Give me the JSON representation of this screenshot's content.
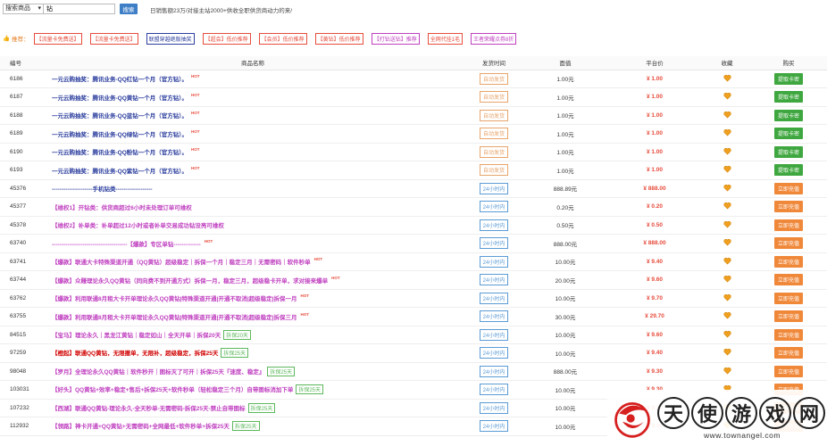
{
  "search": {
    "select_value": "搜索商品",
    "input_value": "钻",
    "button_label": "搜索"
  },
  "banner": "日销售额23万/对接主站2000+供收全职供货商动力的来/",
  "recommend": {
    "label": "推荐：",
    "tags": [
      {
        "text": "【流量卡免费送】",
        "style": "red"
      },
      {
        "text": "【流量卡免费送】",
        "style": "red"
      },
      {
        "text": "联盟穿越绝版抽奖",
        "style": "blue"
      },
      {
        "text": "【超会】低价推荐",
        "style": "red"
      },
      {
        "text": "【会员】低价推荐",
        "style": "red"
      },
      {
        "text": "【黄钻】低价推荐",
        "style": "red"
      },
      {
        "text": "【打钻送钻】推荐",
        "style": "pink"
      },
      {
        "text": "全网代挂1毛",
        "style": "red"
      },
      {
        "text": "王者荣耀点券8折",
        "style": "pink"
      }
    ]
  },
  "table": {
    "headers": [
      "编号",
      "商品名称",
      "发货时间",
      "面值",
      "平台价",
      "收藏",
      "购买"
    ],
    "rows": [
      {
        "id": "6186",
        "name": "一元云购抽奖：腾讯业务-QQ红钻一个月（官方钻）。",
        "hot": "HOT",
        "tag": "",
        "color": "#2c3e9e",
        "time": "自动发货",
        "time_style": "orange",
        "face": "1.00元",
        "price": "¥ 1.00",
        "buy": "提取卡密",
        "buy_style": "green"
      },
      {
        "id": "6187",
        "name": "一元云购抽奖：腾讯业务-QQ黄钻一个月（官方钻）。",
        "hot": "HOT",
        "tag": "",
        "color": "#2c3e9e",
        "time": "自动发货",
        "time_style": "orange",
        "face": "1.00元",
        "price": "¥ 1.00",
        "buy": "提取卡密",
        "buy_style": "green"
      },
      {
        "id": "6188",
        "name": "一元云购抽奖：腾讯业务-QQ蓝钻一个月（官方钻）。",
        "hot": "HOT",
        "tag": "",
        "color": "#2c3e9e",
        "time": "自动发货",
        "time_style": "orange",
        "face": "1.00元",
        "price": "¥ 1.00",
        "buy": "提取卡密",
        "buy_style": "green"
      },
      {
        "id": "6189",
        "name": "一元云购抽奖：腾讯业务-QQ绿钻一个月（官方钻）。",
        "hot": "HOT",
        "tag": "",
        "color": "#2c3e9e",
        "time": "自动发货",
        "time_style": "orange",
        "face": "1.00元",
        "price": "¥ 1.00",
        "buy": "提取卡密",
        "buy_style": "green"
      },
      {
        "id": "6190",
        "name": "一元云购抽奖：腾讯业务-QQ粉钻一个月（官方钻）。",
        "hot": "HOT",
        "tag": "",
        "color": "#2c3e9e",
        "time": "自动发货",
        "time_style": "orange",
        "face": "1.00元",
        "price": "¥ 1.00",
        "buy": "提取卡密",
        "buy_style": "green"
      },
      {
        "id": "6193",
        "name": "一元云购抽奖：腾讯业务-QQ紫钻一个月（官方钻）。",
        "hot": "HOT",
        "tag": "",
        "color": "#2c3e9e",
        "time": "自动发货",
        "time_style": "orange",
        "face": "1.00元",
        "price": "¥ 1.00",
        "buy": "提取卡密",
        "buy_style": "green"
      },
      {
        "id": "45376",
        "name": "---------------------手机钻类-------------------",
        "hot": "",
        "tag": "",
        "color": "#2c3e9e",
        "time": "24小时内",
        "time_style": "blue",
        "face": "888.89元",
        "price": "¥ 888.00",
        "buy": "立即充值",
        "buy_style": "orange"
      },
      {
        "id": "45377",
        "name": "【维权1】开钻类：供货商超过6小时未处理订单可维权",
        "hot": "",
        "tag": "",
        "color": "#c040c0",
        "time": "24小时内",
        "time_style": "blue",
        "face": "0.20元",
        "price": "¥ 0.20",
        "buy": "立即充值",
        "buy_style": "orange"
      },
      {
        "id": "45378",
        "name": "【维权2】补单类：补单超过12小时或者补单交易成功钻没亮可维权",
        "hot": "",
        "tag": "",
        "color": "#c040c0",
        "time": "24小时内",
        "time_style": "blue",
        "face": "0.50元",
        "price": "¥ 0.50",
        "buy": "立即充值",
        "buy_style": "orange"
      },
      {
        "id": "63740",
        "name": "---------------------------------------【爆款】专区单钻--------------",
        "hot": "HOT",
        "tag": "",
        "color": "#c040c0",
        "time": "24小时内",
        "time_style": "blue",
        "face": "888.00元",
        "price": "¥ 888.00",
        "buy": "立即充值",
        "buy_style": "orange"
      },
      {
        "id": "63741",
        "name": "【爆款】联通大卡特殊渠道开通（QQ黄钻）超级稳定｜拆保一个月｜稳定三月｜无需密码｜软件秒单",
        "hot": "HOT",
        "tag": "",
        "color": "#c040c0",
        "time": "24小时内",
        "time_style": "blue",
        "face": "10.00元",
        "price": "¥ 9.40",
        "buy": "立即充值",
        "buy_style": "orange"
      },
      {
        "id": "63744",
        "name": "【爆款】众赚理论永久QQ黄钻（同向费不到开通方式）拆保一月，稳定三月，超级稳卡开单，求对接来爆单",
        "hot": "HOT",
        "tag": "",
        "color": "#c040c0",
        "time": "24小时内",
        "time_style": "blue",
        "face": "20.00元",
        "price": "¥ 9.60",
        "buy": "立即充值",
        "buy_style": "orange"
      },
      {
        "id": "63762",
        "name": "【爆款】利用联通8月租大卡开单理论永久QQ黄钻|特殊渠道开通|开通不取消|超级稳定|拆保一月",
        "hot": "HOT",
        "tag": "",
        "color": "#c040c0",
        "time": "24小时内",
        "time_style": "blue",
        "face": "10.00元",
        "price": "¥ 9.70",
        "buy": "立即充值",
        "buy_style": "orange"
      },
      {
        "id": "63755",
        "name": "【爆款】利用联通8月租大卡开单理论永久QQ黄钻|特殊渠道开通|开通不取消|超级稳定|拆保三月",
        "hot": "HOT",
        "tag": "",
        "color": "#c040c0",
        "time": "24小时内",
        "time_style": "blue",
        "face": "30.00元",
        "price": "¥ 29.70",
        "buy": "立即充值",
        "buy_style": "orange"
      },
      {
        "id": "84515",
        "name": "【宝马】理论永久｜黑龙江黄钻｜稳定如山｜全天开单｜拆保20天",
        "hot": "",
        "tag": "拆保20天",
        "color": "#c040c0",
        "time": "24小时内",
        "time_style": "blue",
        "face": "10.00元",
        "price": "¥ 9.60",
        "buy": "立即充值",
        "buy_style": "orange"
      },
      {
        "id": "97259",
        "name": "【橙起】联通QQ黄钻，无限撤单，无限补，超级稳定，拆保25天",
        "hot": "",
        "tag": "拆保25天",
        "color": "#d00000",
        "time": "24小时内",
        "time_style": "blue",
        "face": "10.00元",
        "price": "¥ 9.40",
        "buy": "立即充值",
        "buy_style": "orange"
      },
      {
        "id": "98048",
        "name": "【罗月】全理论永久QQ黄钻｜软件秒开｜图标灭了可开｜拆保25天『速度、稳定』",
        "hot": "",
        "tag": "拆保25天",
        "color": "#c040c0",
        "time": "24小时内",
        "time_style": "blue",
        "face": "888.00元",
        "price": "¥ 9.30",
        "buy": "立即充值",
        "buy_style": "orange"
      },
      {
        "id": "103031",
        "name": "【好头】QQ黄钻+效率+稳定+售后+拆保25天+软件秒单（轻松稳定三个月）自带图标消加下单",
        "hot": "",
        "tag": "拆保25天",
        "color": "#c040c0",
        "time": "24小时内",
        "time_style": "blue",
        "face": "10.00元",
        "price": "¥ 9.30",
        "buy": "立即充值",
        "buy_style": "orange"
      },
      {
        "id": "107232",
        "name": "【西湖】联通QQ黄钻-理论永久-全天秒单-无需密码-拆保25天-禁止自带图标",
        "hot": "",
        "tag": "拆保25天",
        "color": "#c040c0",
        "time": "24小时内",
        "time_style": "blue",
        "face": "10.00元",
        "price": "¥ 9.30",
        "buy": "立即充值",
        "buy_style": "orange"
      },
      {
        "id": "112932",
        "name": "【领路】神卡开通+QQ黄钻+无需密码+全网最低+软件秒单+拆保25天",
        "hot": "",
        "tag": "拆保25天",
        "color": "#c040c0",
        "time": "24小时内",
        "time_style": "blue",
        "face": "10.00元",
        "price": "¥ 9.30",
        "buy": "立即充值",
        "buy_style": "orange"
      }
    ]
  },
  "watermark": {
    "chars": [
      "天",
      "使",
      "游",
      "戏",
      "网"
    ],
    "url": "www.townangel.com"
  },
  "colors": {
    "price": "#e74c3c",
    "fav": "#f0a020",
    "buy_green": "#3fa73f",
    "buy_orange": "#f0883a"
  }
}
